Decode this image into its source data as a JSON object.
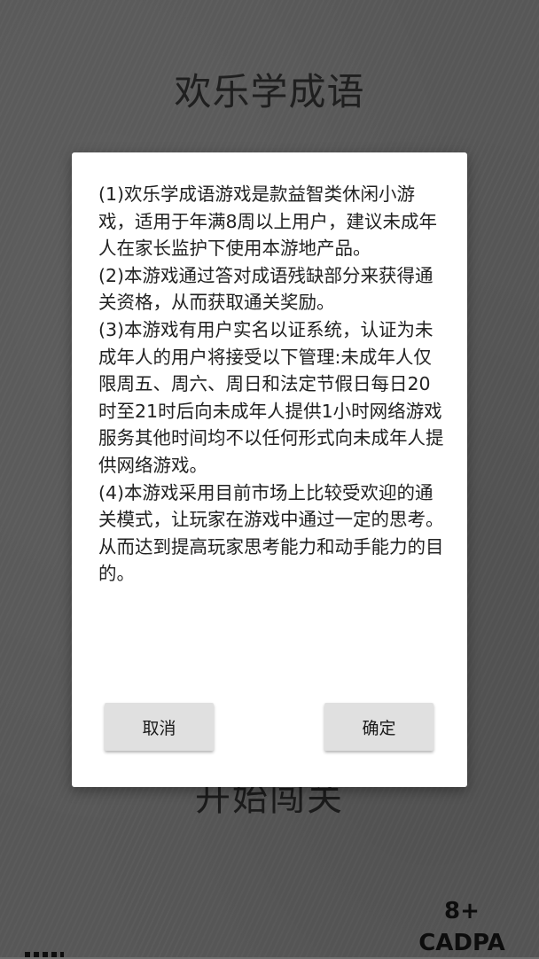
{
  "app": {
    "title": "欢乐学成语",
    "start_button_label": "开始闯关"
  },
  "age_rating": {
    "age": "8+",
    "org": "CADPA"
  },
  "dialog": {
    "paragraphs": [
      "(1)欢乐学成语游戏是款益智类休闲小游戏，适用于年满8周以上用户，建议未成年人在家长监护下使用本游地产品。",
      "(2)本游戏通过答对成语残缺部分来获得通关资格，从而获取通关奖励。",
      "(3)本游戏有用户实名以证系统，认证为未成年人的用户将接受以下管理:未成年人仅限周五、周六、周日和法定节假日每日20时至21时后向未成年人提供1小时网络游戏服务其他时间均不以任何形式向未成年人提供网络游戏。",
      "(4)本游戏采用目前市场上比较受欢迎的通关模式，让玩家在游戏中通过一定的思考。从而达到提高玩家思考能力和动手能力的目的。"
    ],
    "cancel_label": "取消",
    "confirm_label": "确定"
  },
  "colors": {
    "background": "#6d6d6d",
    "dialog": "#ffffff",
    "button": "#e0e0e0"
  }
}
